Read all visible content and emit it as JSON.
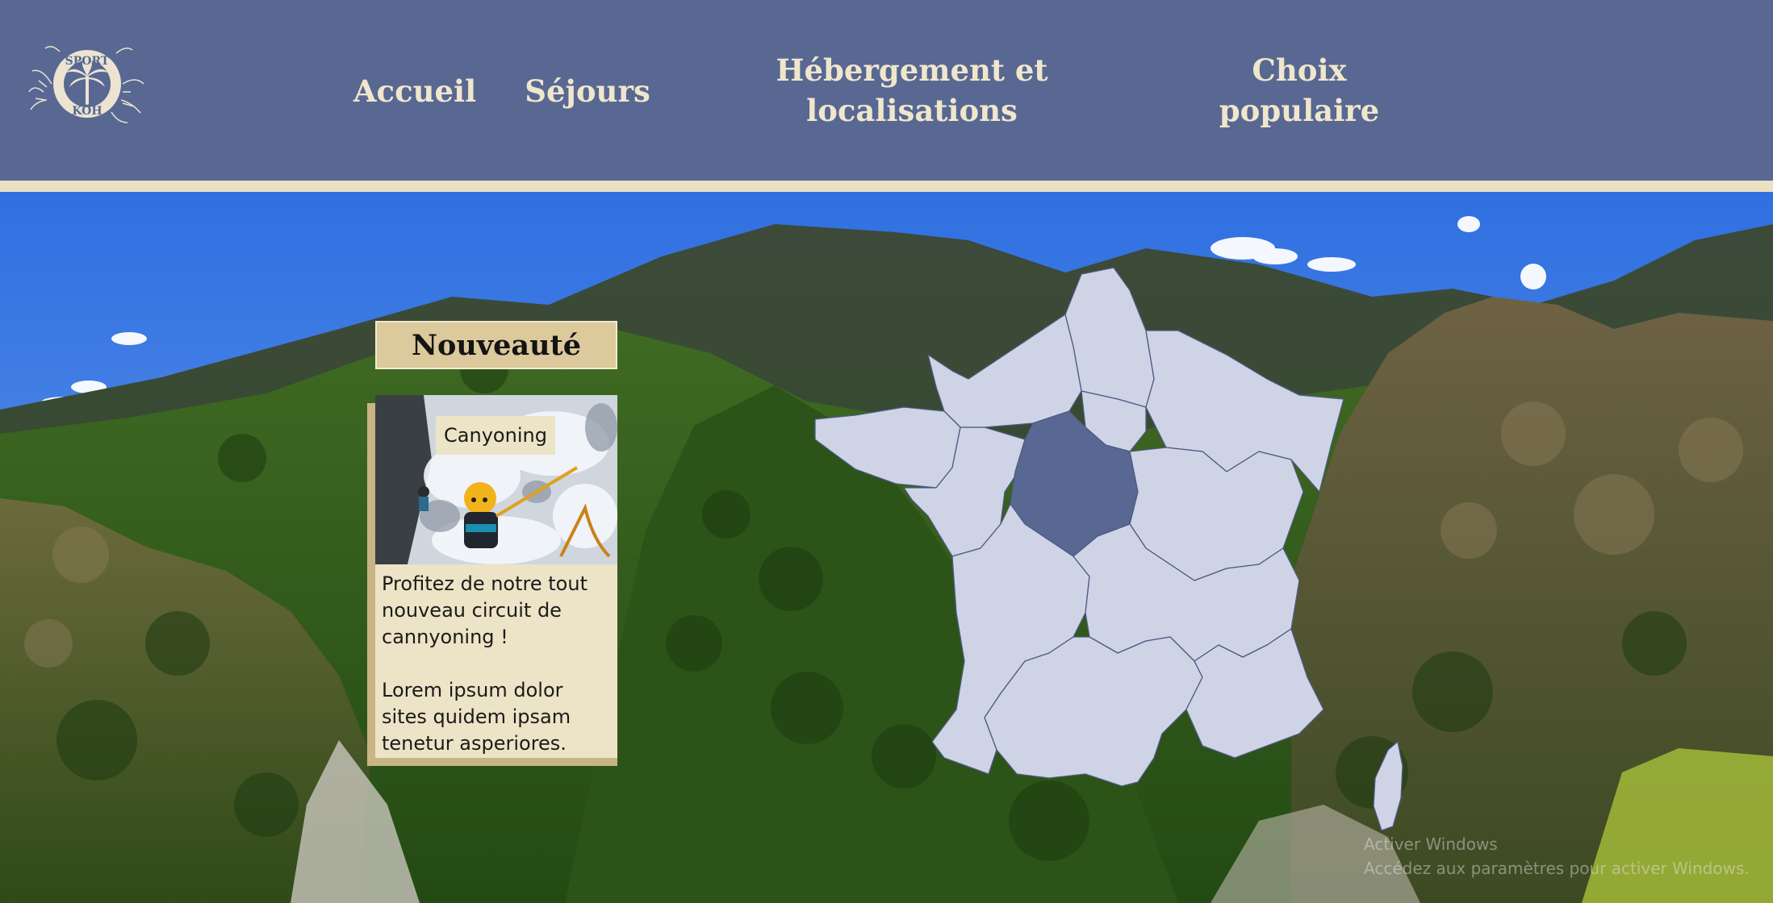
{
  "header": {
    "logo": {
      "icon": "sport-koh-palm-logo",
      "text_top": "SPORT",
      "text_bottom": "KOH"
    },
    "nav": [
      {
        "label": "Accueil"
      },
      {
        "label": "Séjours"
      },
      {
        "label": "Hébergement et localisations"
      },
      {
        "label": "Choix populaire"
      }
    ]
  },
  "featured": {
    "title": "Nouveauté",
    "tag": "Canyoning",
    "paragraphs": [
      "Profitez de notre tout nouveau circuit de cannyoning !",
      "Lorem ipsum dolor sites quidem ipsam tenetur asperiores."
    ]
  },
  "map": {
    "type": "france-regions",
    "highlighted_region": "Centre-Val de Loire"
  },
  "colors": {
    "header_bg": "#586893",
    "header_text": "#f0e6cb",
    "accent_stripe": "#ebe0c4",
    "card_bg": "#ede3c6",
    "card_title_bg": "#dcc99c",
    "map_region": "#ced4e6",
    "map_highlight": "#586893"
  },
  "watermark": {
    "line1": "Activer Windows",
    "line2": "Accédez aux paramètres pour activer Windows."
  }
}
